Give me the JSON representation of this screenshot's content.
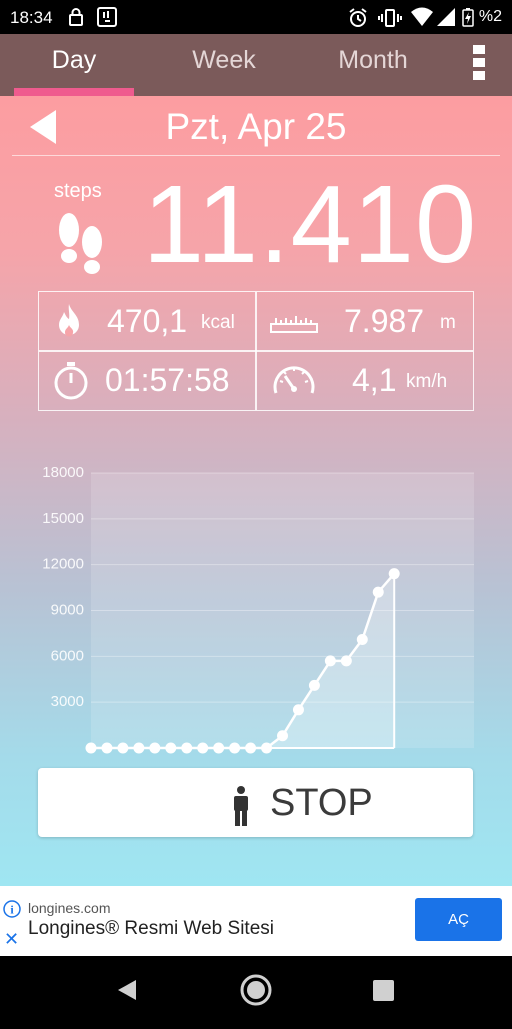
{
  "status": {
    "time": "18:34",
    "battery": "%2"
  },
  "tabs": [
    {
      "label": "Day",
      "active": true
    },
    {
      "label": "Week",
      "active": false
    },
    {
      "label": "Month",
      "active": false
    }
  ],
  "date": "Pzt, Apr 25",
  "steps": {
    "label": "steps",
    "value": "11.410"
  },
  "stats": {
    "calories": {
      "value": "470,1",
      "unit": "kcal"
    },
    "distance": {
      "value": "7.987",
      "unit": "m"
    },
    "duration": {
      "value": "01:57:58"
    },
    "speed": {
      "value": "4,1",
      "unit": "km/h"
    }
  },
  "stop_button": {
    "label": "STOP"
  },
  "ad": {
    "domain": "longines.com",
    "headline": "Longines® Resmi Web Sitesi",
    "cta": "AÇ",
    "close_glyph": "✕",
    "info_glyph": "i"
  },
  "colors": {
    "tabbar": "#7b5a5a",
    "tab_indicator": "#ef5b8e",
    "ad_button": "#1a73e8"
  },
  "chart_data": {
    "type": "line",
    "x": [
      0,
      1,
      2,
      3,
      4,
      5,
      6,
      7,
      8,
      9,
      10,
      11,
      12,
      13,
      14,
      15,
      16,
      17,
      18,
      19
    ],
    "values": [
      0,
      0,
      0,
      0,
      0,
      0,
      0,
      0,
      0,
      0,
      0,
      0,
      800,
      2500,
      4100,
      5700,
      5700,
      7100,
      10200,
      11410
    ],
    "ylim": [
      0,
      18000
    ],
    "xlim": [
      0,
      24
    ],
    "yticks": [
      "3000",
      "6000",
      "9000",
      "12000",
      "15000",
      "18000"
    ],
    "xticks": [
      "2",
      "4",
      "6",
      "8",
      "10",
      "12",
      "14",
      "16",
      "18",
      "20",
      "22",
      "24"
    ],
    "grid": true,
    "title": "",
    "xlabel": "",
    "ylabel": ""
  }
}
